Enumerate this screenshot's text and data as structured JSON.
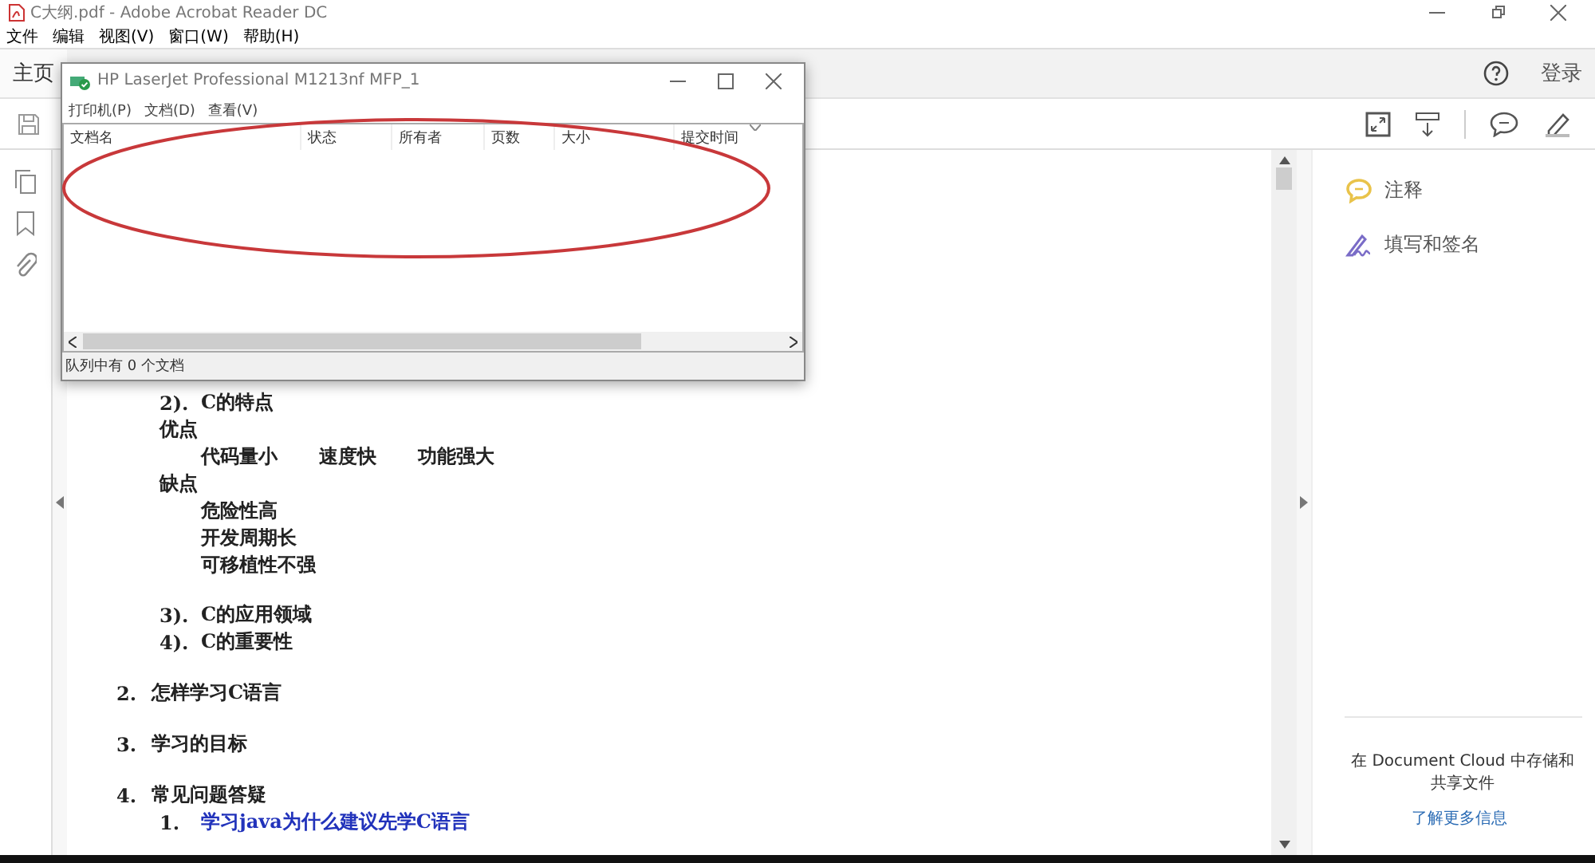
{
  "window": {
    "title": "C大纲.pdf - Adobe Acrobat Reader DC"
  },
  "menu": [
    "文件",
    "编辑",
    "视图(V)",
    "窗口(W)",
    "帮助(H)"
  ],
  "tabs": [
    {
      "label": "主页",
      "selected": true
    }
  ],
  "login": "登录",
  "document": {
    "outline": [
      {
        "children": [
          {
            "number": "2).",
            "text": "C的特点",
            "children": [
              {
                "text": "优点",
                "children": [
                  {
                    "texts": [
                      "代码量小",
                      "速度快",
                      "功能强大"
                    ]
                  }
                ]
              },
              {
                "text": "缺点",
                "children": [
                  {
                    "text": "危险性高"
                  },
                  {
                    "text": "开发周期长"
                  },
                  {
                    "text": "可移植性不强"
                  }
                ]
              }
            ]
          },
          {
            "number": "3).",
            "text": "C的应用领域"
          },
          {
            "number": "4).",
            "text": "C的重要性"
          }
        ]
      },
      {
        "number": "2.",
        "text": "怎样学习C语言"
      },
      {
        "number": "3.",
        "text": "学习的目标"
      },
      {
        "number": "4.",
        "text": "常见问题答疑",
        "children": [
          {
            "number": "1.",
            "text": "学习java为什么建议先学C语言",
            "kind": "link"
          }
        ]
      }
    ]
  },
  "right_panel": {
    "tools": [
      {
        "label": "注释",
        "kind": "comment"
      },
      {
        "label": "填写和签名",
        "kind": "sign"
      }
    ],
    "cloud_text": "在 Document Cloud 中存储和共享文件",
    "link": "了解更多信息"
  },
  "print_dialog": {
    "title": "HP LaserJet Professional M1213nf MFP_1",
    "menu": [
      "打印机(P)",
      "文档(D)",
      "查看(V)"
    ],
    "columns": [
      "文档名",
      "状态",
      "所有者",
      "页数",
      "大小",
      "提交时间"
    ],
    "status": "队列中有 0 个文档"
  }
}
